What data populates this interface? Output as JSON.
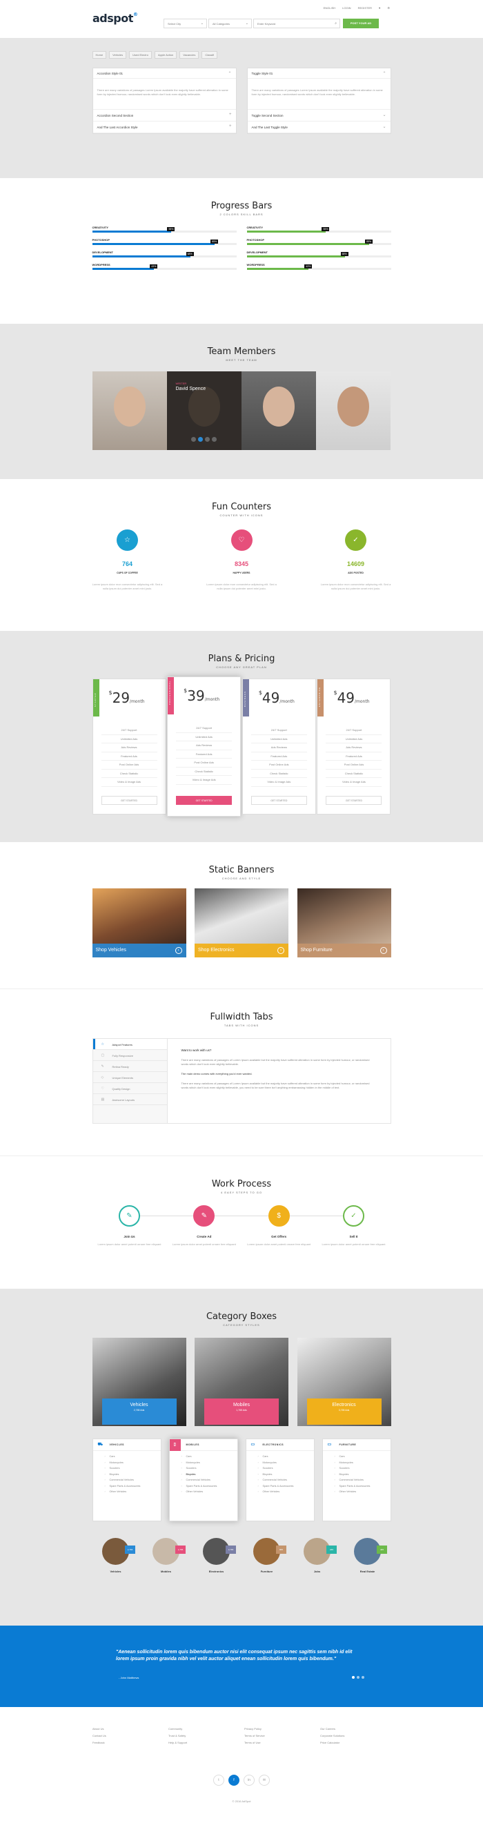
{
  "header": {
    "logo_main": "adspot",
    "logo_mark": "®",
    "links": [
      "ENGLISH",
      "LOGIN",
      "REGISTER",
      "♥",
      "⚙"
    ],
    "search_city": "Select City",
    "search_category": "All Categories",
    "search_keyword": "Enter Keyword",
    "post_button": "POST YOUR AD"
  },
  "breadcrumbs": [
    "Home",
    "Vehicles",
    "Used Electro",
    "Apple Action",
    "Vacancies",
    "Classifi"
  ],
  "accordion_left": {
    "title": "Accordion Style 01",
    "body": "There are many variations of passages Lorem Ipsum available the majority have suffered alteration in some form by injected humour, randomised words which don't look even slightly believable.",
    "items": [
      "Accordion Second Section",
      "And The Last Accordion Style"
    ]
  },
  "accordion_right": {
    "title": "Toggle Style 01",
    "body": "There are many variations of passages Lorem Ipsum available the majority have suffered alteration in some form by injected humour, randomised words which don't look even slightly believable.",
    "items": [
      "Toggle Second Section",
      "And The Last Toggle Style"
    ]
  },
  "progress": {
    "title": "Progress Bars",
    "subtitle": "2 COLORS SKILL BARS",
    "left": [
      {
        "label": "CREATIVITY",
        "value": 55,
        "tip": "55%"
      },
      {
        "label": "PHOTOSHOP",
        "value": 85,
        "tip": "85%"
      },
      {
        "label": "DEVELOPMENT",
        "value": 68,
        "tip": "68%"
      },
      {
        "label": "WORDPRESS",
        "value": 43,
        "tip": "43%"
      }
    ],
    "right": [
      {
        "label": "CREATIVITY",
        "value": 55,
        "tip": "55%"
      },
      {
        "label": "PHOTOSHOP",
        "value": 85,
        "tip": "85%"
      },
      {
        "label": "DEVELOPMENT",
        "value": 68,
        "tip": "68%"
      },
      {
        "label": "WORDPRESS",
        "value": 43,
        "tip": "43%"
      }
    ],
    "colors": {
      "left": "#0a7bd3",
      "right": "#6cb94a"
    }
  },
  "team": {
    "title": "Team Members",
    "subtitle": "MEET THE TEAM",
    "hover_role": "WRITER",
    "hover_name": "David Spence"
  },
  "counters": {
    "title": "Fun Counters",
    "subtitle": "COUNTER WITH ICONS",
    "items": [
      {
        "icon": "☆",
        "value": "764",
        "label": "CUPS OF COFFEE",
        "text": "Lorem ipsum dolor mon consectetur adipiscing elit. Sed a nulla ipsum dui potenter amet mini justo.",
        "color": "#1a9fd1"
      },
      {
        "icon": "♡",
        "value": "8345",
        "label": "HAPPY USERS",
        "text": "Lorem ipsum dolor mon consectetur adipiscing elit. Sed a nulla ipsum dui potenter amet mini justo.",
        "color": "#e64f7b"
      },
      {
        "icon": "✓",
        "value": "14609",
        "label": "ADS POSTED",
        "text": "Lorem ipsum dolor mon consectetur adipiscing elit. Sed a nulla ipsum dui potenter amet mini justo.",
        "color": "#8ab62c"
      }
    ]
  },
  "pricing": {
    "title": "Plans & Pricing",
    "subtitle": "CHOOSE ANY GREAT PLAN",
    "plans": [
      {
        "ribbon": "STARTER",
        "currency": "$",
        "price": "29",
        "period": "/month",
        "color": "#6cb94a"
      },
      {
        "ribbon": "PROFESSIONAL",
        "currency": "$",
        "price": "39",
        "period": "/month",
        "color": "#e64f7b"
      },
      {
        "ribbon": "BUSINESS",
        "currency": "$",
        "price": "49",
        "period": "/month",
        "color": "#7a7fa6"
      },
      {
        "ribbon": "ENTERPRISE",
        "currency": "$",
        "price": "49",
        "period": "/month",
        "color": "#c7906b"
      }
    ],
    "features": [
      "24/7 Support",
      "Unlimited Ads",
      "Ads Reviews",
      "Featured Ads",
      "Post Online Ads",
      "Check Statistic",
      "Video & Image Ads"
    ],
    "button": "GET STARTED"
  },
  "banners": {
    "title": "Static Banners",
    "subtitle": "CHOOSE AND STYLE",
    "items": [
      {
        "label": "Shop Vehicles",
        "color": "#2a8bd6"
      },
      {
        "label": "Shop Electronics",
        "color": "#f0b01b"
      },
      {
        "label": "Shop Furniture",
        "color": "#c4946c"
      }
    ]
  },
  "tabs": {
    "title": "Fullwidth Tabs",
    "subtitle": "TABS WITH ICONS",
    "items": [
      {
        "icon": "☆",
        "label": "Adspot Features"
      },
      {
        "icon": "▢",
        "label": "Fully Responsive"
      },
      {
        "icon": "✎",
        "label": "Retina Ready"
      },
      {
        "icon": "◇",
        "label": "Unique Elements"
      },
      {
        "icon": "♡",
        "label": "Quality Design"
      },
      {
        "icon": "▤",
        "label": "Awesome Layouts"
      }
    ],
    "question": "Want to work with us?",
    "paragraphs": [
      "There are many variations of passages of Lorem Ipsum available but the majority have suffered alteration in some form by injected humour, or randomised words which don't look even slightly believable.",
      "The main demo comes with everything you'd ever wanted.",
      "There are many variations of passages of Lorem Ipsum available but the majority have suffered alteration in some form by injected humour, or randomised words which don't look even slightly believable, you need to be sure there isn't anything embarrassing hidden in the middle of text."
    ]
  },
  "process": {
    "title": "Work Process",
    "subtitle": "4 EASY STEPS TO GO",
    "steps": [
      {
        "icon": "✎",
        "title": "Join Us",
        "text": "Lorem ipsum dolor amet potenti ornare free eliquant",
        "color": "#2ab5a8"
      },
      {
        "icon": "✎",
        "title": "Create Ad",
        "text": "Lorem ipsum dolor amet potenti ornare free eliquant",
        "color": "#e64f7b"
      },
      {
        "icon": "$",
        "title": "Get Offers",
        "text": "Lorem ipsum dolor amet potenti ornare free eliquant",
        "color": "#f0b01b"
      },
      {
        "icon": "✓",
        "title": "Sell It",
        "text": "Lorem ipsum dolor amet potenti ornare free eliquant",
        "color": "#6cb94a"
      }
    ]
  },
  "categories": {
    "title": "Category Boxes",
    "subtitle": "CATEGORY STYLES",
    "big": [
      {
        "name": "Vehicles",
        "count": "2,765 Ads",
        "color": "#2a8bd6"
      },
      {
        "name": "Mobiles",
        "count": "1,765 Ads",
        "color": "#e64f7b"
      },
      {
        "name": "Electronics",
        "count": "3,765 Ads",
        "color": "#f0b01b"
      }
    ],
    "lists": [
      {
        "icon": "⛟",
        "title": "VEHICLES",
        "items": [
          "Cars",
          "Motorcycles",
          "Scooters",
          "Bicycles",
          "Commercial Vehicles",
          "Spare Parts & Accessories",
          "Other Vehicles"
        ]
      },
      {
        "icon": "▯",
        "title": "MOBILES",
        "items": [
          "Cars",
          "Motorcycles",
          "Scooters",
          "Bicycles",
          "Commercial Vehicles",
          "Spare Parts & Accessories",
          "Other Vehicles"
        ]
      },
      {
        "icon": "▭",
        "title": "ELECTRONICS",
        "items": [
          "Cars",
          "Motorcycles",
          "Scooters",
          "Bicycles",
          "Commercial Vehicles",
          "Spare Parts & Accessories",
          "Other Vehicles"
        ]
      },
      {
        "icon": "▭",
        "title": "FURNITURE",
        "items": [
          "Cars",
          "Motorcycles",
          "Scooters",
          "Bicycles",
          "Commercial Vehicles",
          "Spare Parts & Accessories",
          "Other Vehicles"
        ]
      }
    ],
    "circles": [
      {
        "label": "Vehicles",
        "badge": "2,765",
        "color": "#2a8bd6"
      },
      {
        "label": "Mobiles",
        "badge": "1,765",
        "color": "#e64f7b"
      },
      {
        "label": "Electronics",
        "badge": "3,765",
        "color": "#7a7fa6"
      },
      {
        "label": "Furniture",
        "badge": "865",
        "color": "#c4946c"
      },
      {
        "label": "Jobs",
        "badge": "265",
        "color": "#2ab5a8"
      },
      {
        "label": "Real Estate",
        "badge": "465",
        "color": "#6cb94a"
      }
    ]
  },
  "testimonial": {
    "quote": "\"Aenean sollicitudin lorem quis bibendum auctor nisi elit consequat ipsum nec sagittis sem nibh id elit lorem ipsum proin gravida nibh vel velit auctor aliquet enean sollicitudin lorem quis bibendum.\"",
    "author": "- John Matthews"
  },
  "footer": {
    "cols": [
      [
        "About Us",
        "Contact Us",
        "Feedback"
      ],
      [
        "Community",
        "Trust & Safety",
        "Help & Support"
      ],
      [
        "Privacy Policy",
        "Terms of Service",
        "Terms of Use"
      ],
      [
        "Our Careers",
        "Corporate Solutions",
        "Price Calculator"
      ]
    ],
    "social": [
      "t",
      "f",
      "in",
      "✉"
    ],
    "copyright": "© 2016 AdSpot"
  }
}
